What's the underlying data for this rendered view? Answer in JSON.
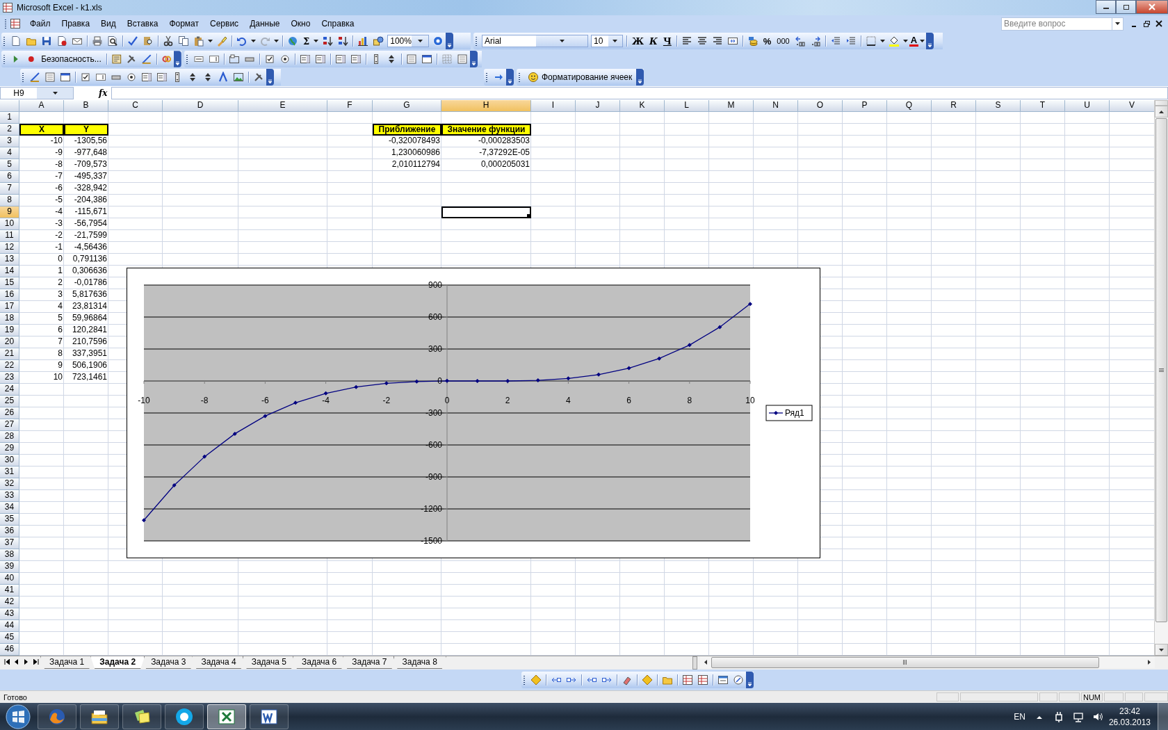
{
  "window": {
    "title": "Microsoft Excel - k1.xls"
  },
  "menu": [
    "Файл",
    "Правка",
    "Вид",
    "Вставка",
    "Формат",
    "Сервис",
    "Данные",
    "Окно",
    "Справка"
  ],
  "help_search": {
    "placeholder": "Введите вопрос"
  },
  "standard_toolbar": {
    "sum_glyph": "Σ",
    "zoom": "100%"
  },
  "formatting_toolbar": {
    "font": "Arial",
    "size": "10",
    "style_buttons": [
      "Ж",
      "К",
      "Ч"
    ],
    "percent": "%",
    "thousands": "000",
    "font_color_glyph": "A"
  },
  "security_toolbar": {
    "button": "Безопасность..."
  },
  "cell_format_toolbar": {
    "button": "Форматирование ячеек"
  },
  "formula_bar": {
    "name_box": "H9",
    "function_label": "fx"
  },
  "sheet": {
    "columns": [
      {
        "label": "A",
        "selected": false
      },
      {
        "label": "B",
        "selected": false
      },
      {
        "label": "C",
        "selected": false
      },
      {
        "label": "D",
        "selected": false
      },
      {
        "label": "E",
        "selected": false
      },
      {
        "label": "F",
        "selected": false
      },
      {
        "label": "G",
        "selected": false
      },
      {
        "label": "H",
        "selected": true
      },
      {
        "label": "I",
        "selected": false
      },
      {
        "label": "J",
        "selected": false
      },
      {
        "label": "K",
        "selected": false
      },
      {
        "label": "L",
        "selected": false
      },
      {
        "label": "M",
        "selected": false
      },
      {
        "label": "N",
        "selected": false
      },
      {
        "label": "O",
        "selected": false
      },
      {
        "label": "P",
        "selected": false
      },
      {
        "label": "Q",
        "selected": false
      },
      {
        "label": "R",
        "selected": false
      },
      {
        "label": "S",
        "selected": false
      },
      {
        "label": "T",
        "selected": false
      },
      {
        "label": "U",
        "selected": false
      },
      {
        "label": "V",
        "selected": false
      }
    ],
    "rows": [
      {
        "label": "1",
        "selected": false
      },
      {
        "label": "2",
        "selected": false
      },
      {
        "label": "3",
        "selected": false
      },
      {
        "label": "4",
        "selected": false
      },
      {
        "label": "5",
        "selected": false
      },
      {
        "label": "6",
        "selected": false
      },
      {
        "label": "7",
        "selected": false
      },
      {
        "label": "8",
        "selected": false
      },
      {
        "label": "9",
        "selected": true
      },
      {
        "label": "10",
        "selected": false
      },
      {
        "label": "11",
        "selected": false
      },
      {
        "label": "12",
        "selected": false
      },
      {
        "label": "13",
        "selected": false
      },
      {
        "label": "14",
        "selected": false
      },
      {
        "label": "15",
        "selected": false
      },
      {
        "label": "16",
        "selected": false
      },
      {
        "label": "17",
        "selected": false
      },
      {
        "label": "18",
        "selected": false
      },
      {
        "label": "19",
        "selected": false
      },
      {
        "label": "20",
        "selected": false
      },
      {
        "label": "21",
        "selected": false
      },
      {
        "label": "22",
        "selected": false
      },
      {
        "label": "23",
        "selected": false
      },
      {
        "label": "24",
        "selected": false
      },
      {
        "label": "25",
        "selected": false
      },
      {
        "label": "26",
        "selected": false
      },
      {
        "label": "27",
        "selected": false
      },
      {
        "label": "28",
        "selected": false
      },
      {
        "label": "29",
        "selected": false
      },
      {
        "label": "30",
        "selected": false
      },
      {
        "label": "31",
        "selected": false
      },
      {
        "label": "32",
        "selected": false
      },
      {
        "label": "33",
        "selected": false
      },
      {
        "label": "34",
        "selected": false
      },
      {
        "label": "35",
        "selected": false
      },
      {
        "label": "36",
        "selected": false
      },
      {
        "label": "37",
        "selected": false
      },
      {
        "label": "38",
        "selected": false
      },
      {
        "label": "39",
        "selected": false
      },
      {
        "label": "40",
        "selected": false
      },
      {
        "label": "41",
        "selected": false
      },
      {
        "label": "42",
        "selected": false
      },
      {
        "label": "43",
        "selected": false
      },
      {
        "label": "44",
        "selected": false
      },
      {
        "label": "45",
        "selected": false
      },
      {
        "label": "46",
        "selected": false
      }
    ],
    "xy_table": {
      "headers": [
        "X",
        "Y"
      ],
      "rows": [
        [
          "-10",
          "-1305,56"
        ],
        [
          "-9",
          "-977,648"
        ],
        [
          "-8",
          "-709,573"
        ],
        [
          "-7",
          "-495,337"
        ],
        [
          "-6",
          "-328,942"
        ],
        [
          "-5",
          "-204,386"
        ],
        [
          "-4",
          "-115,671"
        ],
        [
          "-3",
          "-56,7954"
        ],
        [
          "-2",
          "-21,7599"
        ],
        [
          "-1",
          "-4,56436"
        ],
        [
          "0",
          "0,791136"
        ],
        [
          "1",
          "0,306636"
        ],
        [
          "2",
          "-0,01786"
        ],
        [
          "3",
          "5,817636"
        ],
        [
          "4",
          "23,81314"
        ],
        [
          "5",
          "59,96864"
        ],
        [
          "6",
          "120,2841"
        ],
        [
          "7",
          "210,7596"
        ],
        [
          "8",
          "337,3951"
        ],
        [
          "9",
          "506,1906"
        ],
        [
          "10",
          "723,1461"
        ]
      ]
    },
    "roots_table": {
      "headers": [
        "Приближение",
        "Значение функции"
      ],
      "rows": [
        [
          "-0,320078493",
          "-0,000283503"
        ],
        [
          "1,230060986",
          "-7,37292E-05"
        ],
        [
          "2,010112794",
          "0,000205031"
        ]
      ]
    }
  },
  "chart": {
    "chart_data": {
      "type": "line",
      "grid": true,
      "x": [
        -10,
        -9,
        -8,
        -7,
        -6,
        -5,
        -4,
        -3,
        -2,
        -1,
        0,
        1,
        2,
        3,
        4,
        5,
        6,
        7,
        8,
        9,
        10
      ],
      "series": [
        {
          "name": "Ряд1",
          "color": "#000080",
          "marker": "diamond",
          "values": [
            -1306,
            -978,
            -710,
            -495,
            -329,
            -204,
            -116,
            -57,
            -22,
            -5,
            1,
            0,
            0,
            6,
            24,
            60,
            120,
            211,
            337,
            506,
            723
          ]
        }
      ],
      "xlim": [
        -10,
        10
      ],
      "ylim": [
        -1500,
        900
      ],
      "xticks": [
        -10,
        -8,
        -6,
        -4,
        -2,
        0,
        2,
        4,
        6,
        8,
        10
      ],
      "yticks": [
        -1500,
        -1200,
        -900,
        -600,
        -300,
        0,
        300,
        600,
        900
      ]
    }
  },
  "sheet_tabs": [
    {
      "label": "Задача 1",
      "selected": false
    },
    {
      "label": "Задача 2",
      "selected": true
    },
    {
      "label": "Задача 3",
      "selected": false
    },
    {
      "label": "Задача 4",
      "selected": false
    },
    {
      "label": "Задача 5",
      "selected": false
    },
    {
      "label": "Задача 6",
      "selected": false
    },
    {
      "label": "Задача 7",
      "selected": false
    },
    {
      "label": "Задача 8",
      "selected": false
    }
  ],
  "status_bar": {
    "text": "Готово",
    "indicators": [
      "NUM"
    ]
  },
  "taskbar": {
    "apps": [
      {
        "kind": "browser",
        "selected": false
      },
      {
        "kind": "files",
        "selected": false
      },
      {
        "kind": "notes",
        "selected": false
      },
      {
        "kind": "chat",
        "selected": false
      },
      {
        "kind": "sheet",
        "selected": true
      },
      {
        "kind": "document",
        "selected": false
      }
    ],
    "language": "EN",
    "time": "23:42",
    "date": "26.03.2013"
  }
}
